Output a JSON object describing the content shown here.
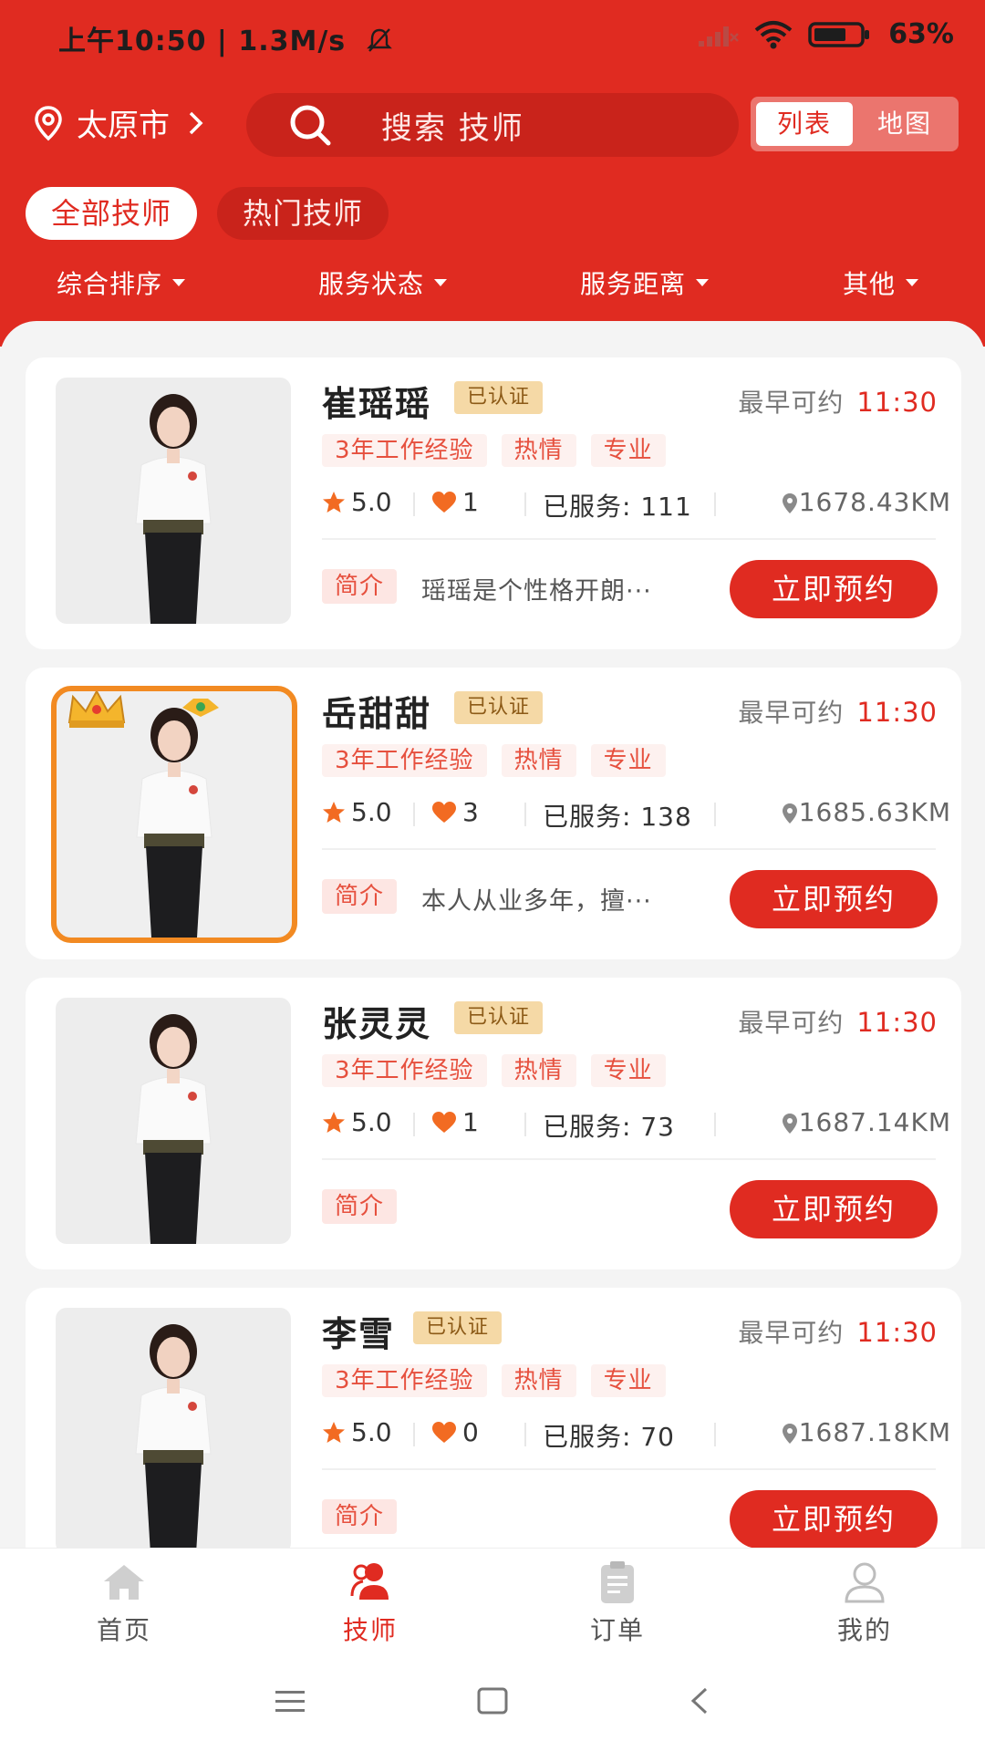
{
  "status": {
    "time": "上午10:50 | 1.3M/s",
    "battery": "63%"
  },
  "location": {
    "city": "太原市"
  },
  "search": {
    "placeholder": "搜索 技师"
  },
  "view_toggle": {
    "list": "列表",
    "map": "地图",
    "active": "list"
  },
  "categories": [
    {
      "label": "全部技师",
      "active": true
    },
    {
      "label": "热门技师",
      "active": false
    }
  ],
  "sort_filters": [
    "综合排序",
    "服务状态",
    "服务距离",
    "其他"
  ],
  "technicians": [
    {
      "name": "崔瑶瑶",
      "certified": "已认证",
      "available_label": "最早可约",
      "available_time": "11:30",
      "tags": [
        "3年工作经验",
        "热情",
        "专业"
      ],
      "rating": "5.0",
      "likes": "1",
      "served": "已服务: 111",
      "distance": "1678.43KM",
      "intro_label": "简介",
      "intro": "瑶瑶是个性格开朗···",
      "book_label": "立即预约",
      "vip": false
    },
    {
      "name": "岳甜甜",
      "certified": "已认证",
      "available_label": "最早可约",
      "available_time": "11:30",
      "tags": [
        "3年工作经验",
        "热情",
        "专业"
      ],
      "rating": "5.0",
      "likes": "3",
      "served": "已服务: 138",
      "distance": "1685.63KM",
      "intro_label": "简介",
      "intro": "本人从业多年，擅···",
      "book_label": "立即预约",
      "vip": true
    },
    {
      "name": "张灵灵",
      "certified": "已认证",
      "available_label": "最早可约",
      "available_time": "11:30",
      "tags": [
        "3年工作经验",
        "热情",
        "专业"
      ],
      "rating": "5.0",
      "likes": "1",
      "served": "已服务: 73",
      "distance": "1687.14KM",
      "intro_label": "简介",
      "intro": "",
      "book_label": "立即预约",
      "vip": false
    },
    {
      "name": "李雪",
      "certified": "已认证",
      "available_label": "最早可约",
      "available_time": "11:30",
      "tags": [
        "3年工作经验",
        "热情",
        "专业"
      ],
      "rating": "5.0",
      "likes": "0",
      "served": "已服务: 70",
      "distance": "1687.18KM",
      "intro_label": "简介",
      "intro": "",
      "book_label": "立即预约",
      "vip": false
    }
  ],
  "bottom_nav": [
    {
      "label": "首页",
      "icon": "home-icon",
      "active": false
    },
    {
      "label": "技师",
      "icon": "technician-icon",
      "active": true
    },
    {
      "label": "订单",
      "icon": "order-icon",
      "active": false
    },
    {
      "label": "我的",
      "icon": "profile-icon",
      "active": false
    }
  ],
  "colors": {
    "brand_red": "#e02b21",
    "gold_badge": "#f5d9a6",
    "vip_frame": "#f28a22"
  }
}
